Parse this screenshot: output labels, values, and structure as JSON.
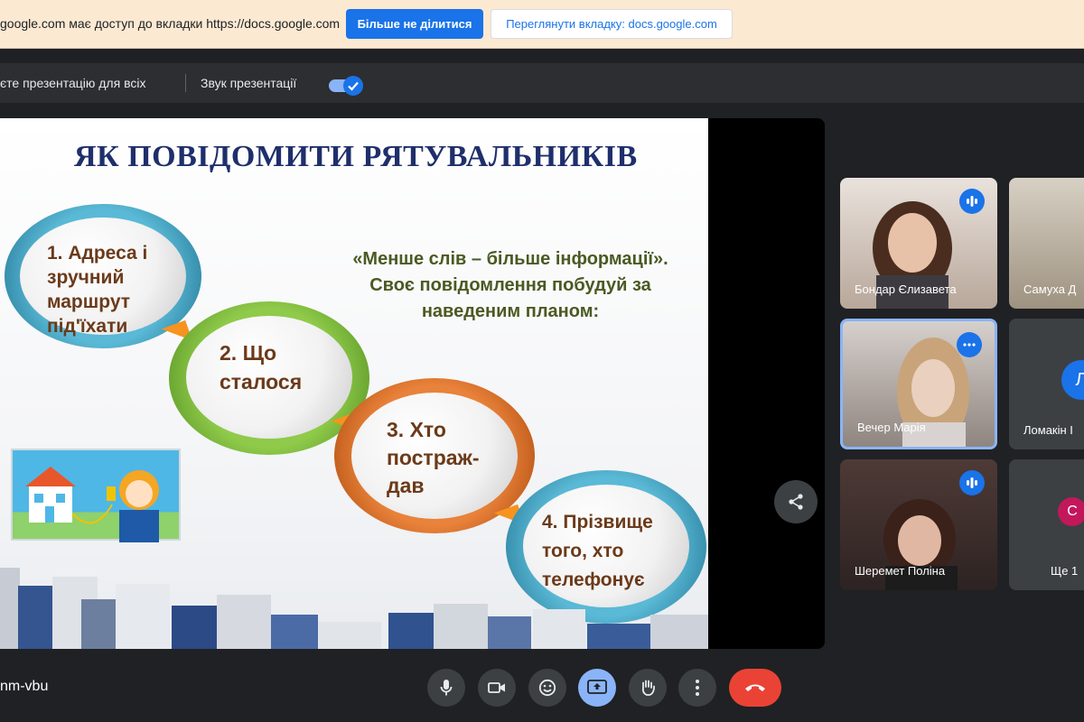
{
  "infobar": {
    "message": "google.com має доступ до вкладки https://docs.google.com",
    "stop_sharing": "Більше не ділитися",
    "view_tab": "Переглянути вкладку: docs.google.com"
  },
  "presentation_bar": {
    "presenting_text": "єте презентацію для всіх",
    "sound_label": "Звук презентації",
    "sound_on": true
  },
  "slide": {
    "title": "ЯК ПОВІДОМИТИ РЯТУВАЛЬНИКІВ",
    "quote_line1": "«Менше слів – більше інформації».",
    "quote_line2": "Своє повідомлення побудуй за",
    "quote_line3": "наведеним планом:",
    "steps": [
      {
        "line1": "1. Адреса і",
        "line2": "зручний",
        "line3": "маршрут",
        "line4": "під'їхати",
        "color": "#2e8fb0"
      },
      {
        "line1": "2. Що",
        "line2": "сталося",
        "color": "#6aa12a"
      },
      {
        "line1": "3. Хто",
        "line2": "постраж-",
        "line3": "дав",
        "color": "#c85a12"
      },
      {
        "line1": "4. Прізвище",
        "line2": "того, хто",
        "line3": "телефонує",
        "color": "#2e8fb0"
      }
    ]
  },
  "participants": [
    {
      "name": "Бондар Єлизавета",
      "badge": "speaking-icon"
    },
    {
      "name": "Самуха Д"
    },
    {
      "name": "Вечер Марія",
      "badge": "more-icon",
      "selected": true
    },
    {
      "name": "Ломакін І",
      "avatar_letter": "Л"
    },
    {
      "name": "Шеремет Поліна",
      "badge": "speaking-icon"
    },
    {
      "name": "Ще 1",
      "avatar_letter": "С"
    }
  ],
  "bottom": {
    "meeting_code": "nm-vbu"
  },
  "colors": {
    "accent": "#1a73e8",
    "end_call": "#ea4335",
    "present_active": "#8ab4f8"
  }
}
